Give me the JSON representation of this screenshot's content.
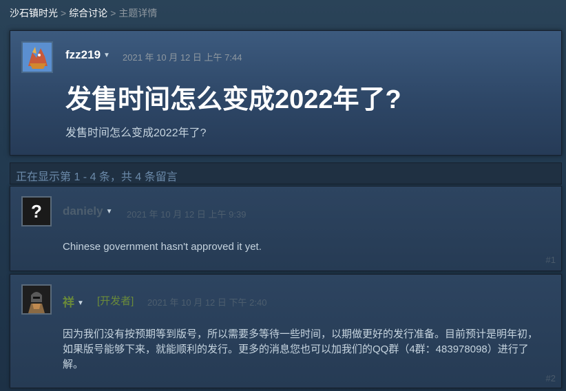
{
  "breadcrumb": {
    "items": [
      "沙石镇时光",
      "综合讨论"
    ],
    "separator": ">",
    "current": "主题详情"
  },
  "topic": {
    "author": "fzz219",
    "date": "2021 年 10 月 12 日 上午 7:44",
    "title": "发售时间怎么变成2022年了?",
    "body": "发售时间怎么变成2022年了?"
  },
  "count_text": "正在显示第 1 - 4 条，共 4 条留言",
  "comments": [
    {
      "author": "daniely",
      "date": "2021 年 10 月 12 日 上午 9:39",
      "body": "Chinese government hasn't approved it yet.",
      "number": "#1",
      "avatar_glyph": "?"
    },
    {
      "author": "祥",
      "tag": "[开发者]",
      "date": "2021 年 10 月 12 日 下午 2:40",
      "body": "因为我们没有按预期等到版号，所以需要多等待一些时间，以期做更好的发行准备。目前预计是明年初，如果版号能够下来，就能顺利的发行。更多的消息您也可以加我们的QQ群（4群：483978098）进行了解。",
      "number": "#2"
    }
  ],
  "icons": {
    "dropdown": "chevron-down-icon",
    "dropdown_glyph": "▼"
  },
  "colors": {
    "developer_accent": "#6a8a3a",
    "link": "#ffffff"
  }
}
